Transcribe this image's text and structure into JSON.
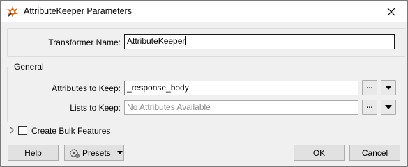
{
  "window": {
    "title": "AttributeKeeper Parameters"
  },
  "transformer_name": {
    "label": "Transformer Name:",
    "value": "AttributeKeeper"
  },
  "general": {
    "group_title": "General",
    "attributes_to_keep": {
      "label": "Attributes to Keep:",
      "value": "_response_body"
    },
    "lists_to_keep": {
      "label": "Lists to Keep:",
      "placeholder": "No Attributes Available"
    },
    "ellipsis_label": "..."
  },
  "bulk": {
    "label": "Create Bulk Features",
    "checked": false
  },
  "footer": {
    "help_label": "Help",
    "presets_label": "Presets",
    "ok_label": "OK",
    "cancel_label": "Cancel"
  }
}
